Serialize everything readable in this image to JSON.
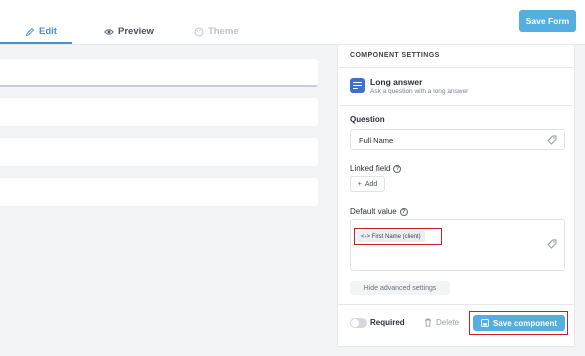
{
  "header": {
    "tabs": [
      {
        "label": "Edit",
        "icon": "pencil-icon",
        "active": true
      },
      {
        "label": "Preview",
        "icon": "eye-icon",
        "active": false
      },
      {
        "label": "Theme",
        "icon": "palette-icon",
        "active": false,
        "disabled": true
      }
    ],
    "save_form_label": "Save Form"
  },
  "panel": {
    "title": "COMPONENT SETTINGS",
    "component": {
      "icon": "long-answer-icon",
      "name": "Long answer",
      "description": "Ask a question with a long answer"
    },
    "question": {
      "label": "Question",
      "value": "Full Name"
    },
    "linked_field": {
      "label": "Linked field",
      "add_label": "Add"
    },
    "default_value": {
      "label": "Default value",
      "chip": "<-> First Name (client)"
    },
    "hide_advanced_label": "Hide advanced settings",
    "footer": {
      "required_label": "Required",
      "required_on": false,
      "delete_label": "Delete",
      "save_label": "Save component"
    }
  },
  "colors": {
    "accent": "#4a90c2",
    "primary_button": "#55aee0",
    "highlight": "#c8202a",
    "component_icon": "#3b6fd6"
  }
}
